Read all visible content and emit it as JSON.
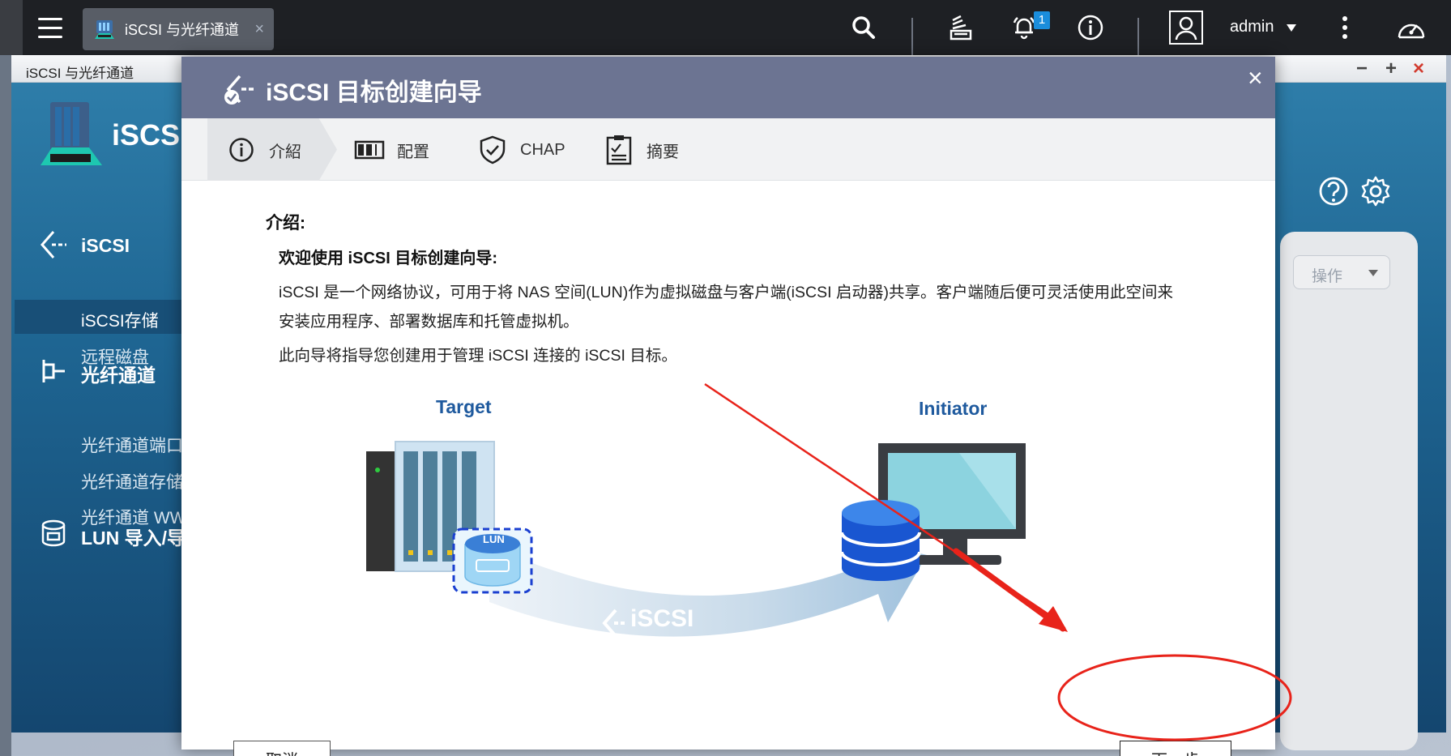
{
  "topbar": {
    "tab_label": "iSCSI 与光纤通道",
    "tab_close": "×",
    "notification_count": "1",
    "username": "admin"
  },
  "app": {
    "window_title": "iSCSI 与光纤通道",
    "name": "iSCSI",
    "controls": {
      "minimize": "−",
      "maximize": "+",
      "close": "×"
    },
    "sidebar": {
      "sections": [
        {
          "label": "iSCSI",
          "items": [
            "iSCSI存储",
            "远程磁盘"
          ]
        },
        {
          "label": "光纤通道",
          "items": [
            "光纤通道端口",
            "光纤通道存储",
            "光纤通道 WWPN"
          ]
        },
        {
          "label": "LUN 导入/导出",
          "items": []
        }
      ]
    },
    "actions_label": "操作"
  },
  "dialog": {
    "title": "iSCSI 目标创建向导",
    "close": "×",
    "steps": [
      {
        "label": "介紹",
        "icon": "info-icon",
        "active": true
      },
      {
        "label": "配置",
        "icon": "config-icon",
        "active": false
      },
      {
        "label": "CHAP",
        "icon": "shield-check-icon",
        "active": false
      },
      {
        "label": "摘要",
        "icon": "checklist-icon",
        "active": false
      }
    ],
    "intro_heading": "介绍:",
    "intro_subheading": "欢迎使用 iSCSI 目标创建向导:",
    "intro_paragraph_1": "iSCSI 是一个网络协议，可用于将 NAS 空间(LUN)作为虚拟磁盘与客户端(iSCSI 启动器)共享。客户端随后便可灵活使用此空间来安装应用程序、部署数据库和托管虚拟机。",
    "intro_paragraph_2": "此向导将指导您创建用于管理 iSCSI 连接的 iSCSI 目标。",
    "diagram": {
      "target_label": "Target",
      "initiator_label": "Initiator",
      "lun_label": "LUN",
      "protocol_label": "iSCSI"
    },
    "buttons": {
      "cancel": "取消",
      "next": "下一步"
    }
  },
  "colors": {
    "dialog_header": "#6c7492",
    "app_background": "#1e6592",
    "annotation_red": "#e8231a",
    "diagram_label_blue": "#1f5a9e"
  }
}
